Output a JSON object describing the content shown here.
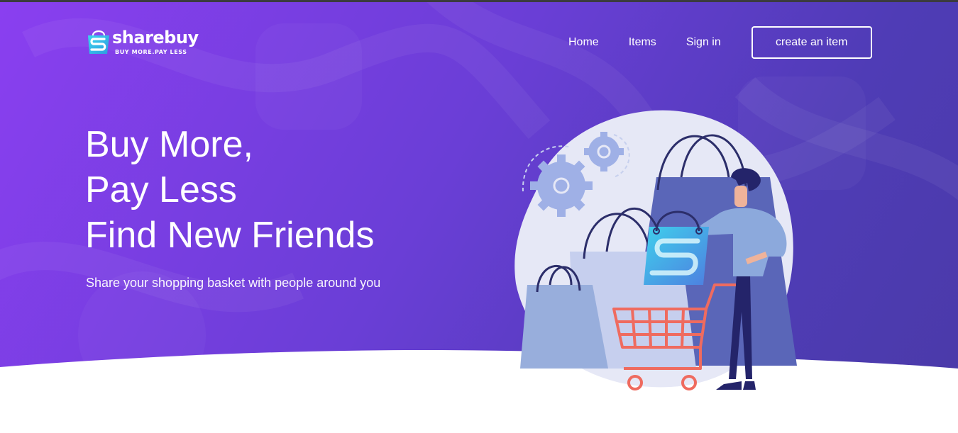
{
  "brand": {
    "name": "sharebuy",
    "tagline": "BUY MORE.PAY LESS",
    "colors": {
      "primary": "#7b3fe4",
      "accent": "#35c9e4",
      "cart": "#ef6b5f",
      "bag": "#5a66b8"
    }
  },
  "nav": {
    "items": [
      {
        "label": "Home"
      },
      {
        "label": "Items"
      },
      {
        "label": "Sign in"
      }
    ],
    "cta_label": "create an item"
  },
  "hero": {
    "headline": [
      "Buy More,",
      "Pay Less",
      "Find New Friends"
    ],
    "subtext": "Share your shopping basket with people around you"
  },
  "illustration": {
    "subject": "shopping-illustration",
    "icons": [
      "gear-icon",
      "shopping-bag-icon",
      "shopping-cart-icon",
      "shopper-figure"
    ]
  }
}
